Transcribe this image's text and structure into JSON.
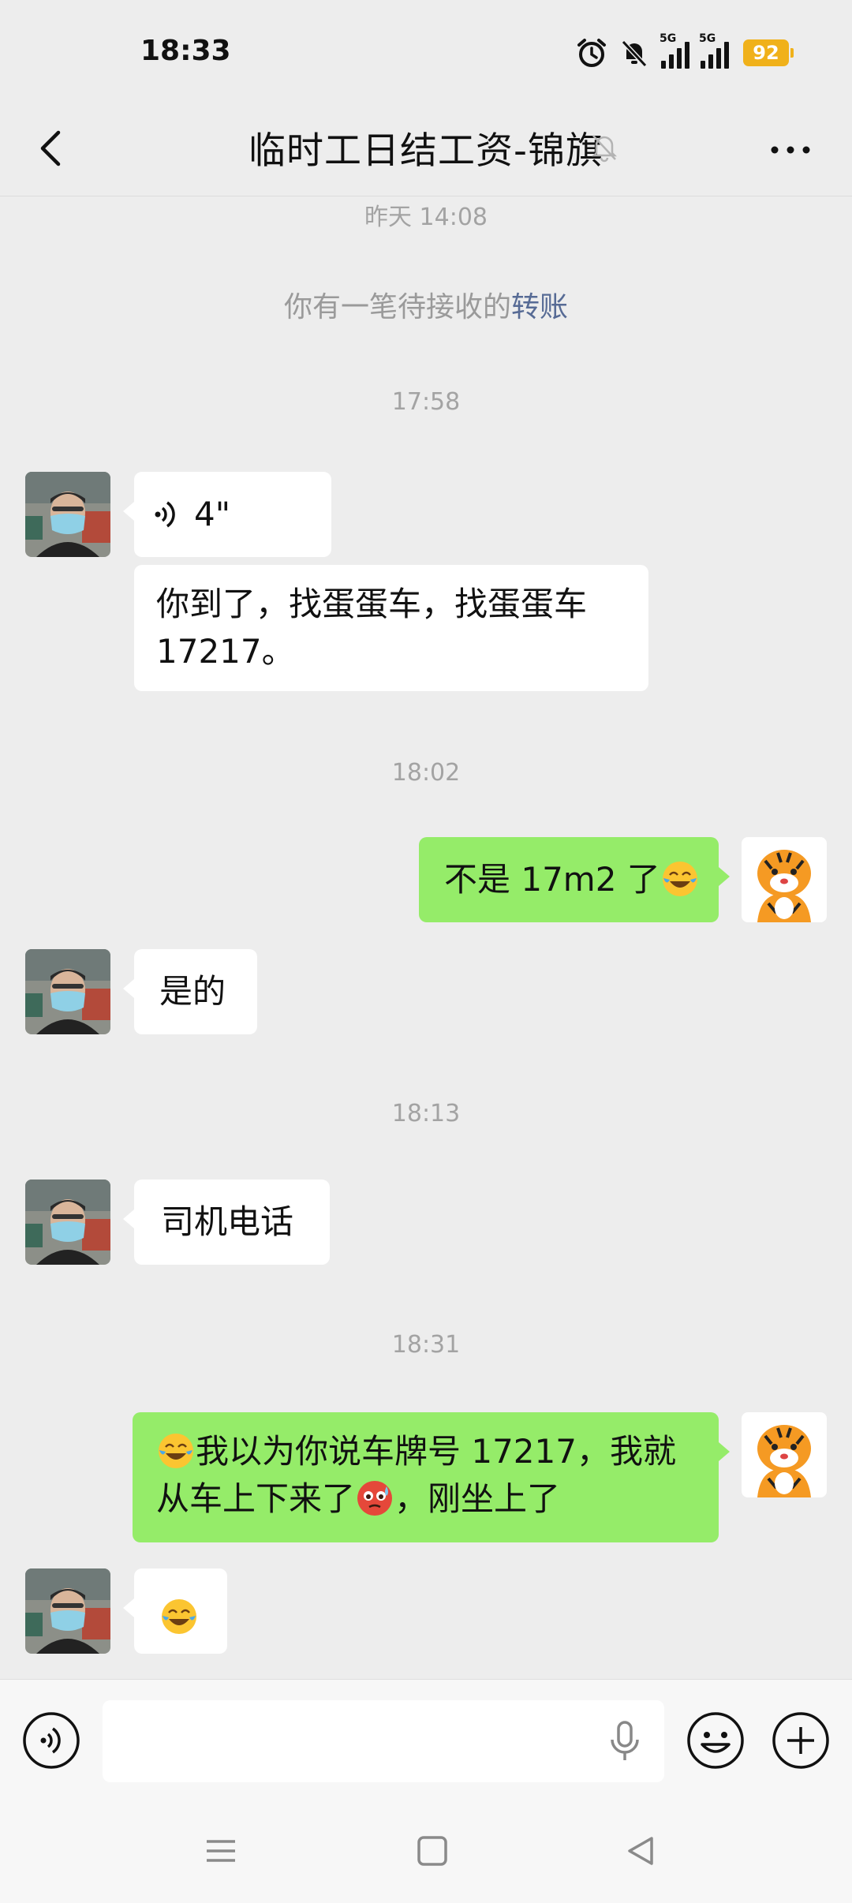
{
  "status": {
    "time": "18:33",
    "net1": "5G",
    "net2": "5G",
    "battery": "92"
  },
  "header": {
    "title": "临时工日结工资-锦旗"
  },
  "chat": {
    "ts1": "昨天 14:08",
    "transfer_prefix": "你有一笔待接收的",
    "transfer_link": "转账",
    "ts2": "17:58",
    "voice_duration": "4\"",
    "msg1": "你到了，找蛋蛋车，找蛋蛋车17217。",
    "ts3": "18:02",
    "msg2": "不是 17m2 了",
    "msg3": "是的",
    "ts4": "18:13",
    "msg4": "司机电话",
    "ts5": "18:31",
    "msg5_a": "我以为你说车牌号 17217，我就从车上下来了",
    "msg5_b": "，刚坐上了"
  },
  "colors": {
    "self_bubble": "#95ec69",
    "other_bubble": "#ffffff",
    "link": "#576b95",
    "battery": "#f0b11a"
  },
  "icons": [
    "back-icon",
    "mute-bell-icon",
    "more-icon",
    "voice-icon",
    "microphone-icon",
    "emoji-icon",
    "plus-icon",
    "tears-of-joy-emoji",
    "flushed-emoji",
    "menu-icon",
    "home-icon",
    "back-triangle-icon"
  ]
}
